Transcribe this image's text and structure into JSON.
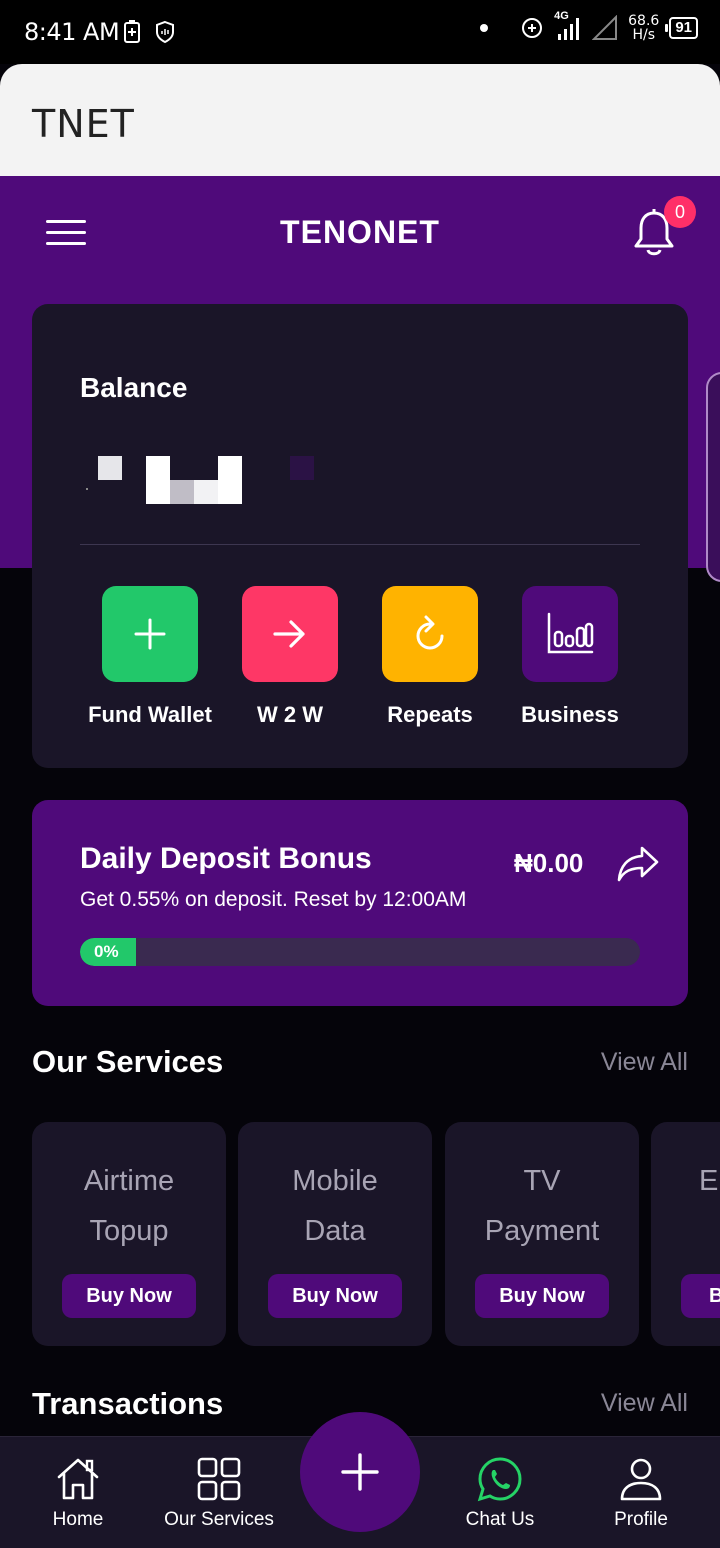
{
  "status_bar": {
    "time": "8:41 AM",
    "network": "4G",
    "speed_value": "68.6",
    "speed_unit": "H/s",
    "battery": "91"
  },
  "app": {
    "window_title": "TNET"
  },
  "header": {
    "brand": "TENONET",
    "notification_count": "0"
  },
  "balance": {
    "label": "Balance"
  },
  "actions": [
    {
      "label": "Fund Wallet",
      "icon": "plus-icon",
      "color": "#22c86a"
    },
    {
      "label": "W 2 W",
      "icon": "arrow-right-icon",
      "color": "#fe3766"
    },
    {
      "label": "Repeats",
      "icon": "refresh-icon",
      "color": "#ffb300"
    },
    {
      "label": "Business",
      "icon": "bar-chart-icon",
      "color": "#4f0a7a"
    }
  ],
  "bonus": {
    "title": "Daily Deposit Bonus",
    "amount": "₦0.00",
    "subtitle": "Get 0.55% on deposit. Reset by 12:00AM",
    "progress_label": "0%",
    "progress_fraction": 0
  },
  "services": {
    "title": "Our Services",
    "view_all": "View All",
    "items": [
      {
        "line1": "Airtime",
        "line2": "Topup",
        "button": "Buy Now"
      },
      {
        "line1": "Mobile",
        "line2": "Data",
        "button": "Buy Now"
      },
      {
        "line1": "TV",
        "line2": "Payment",
        "button": "Buy Now"
      },
      {
        "line1": "El",
        "line2": "",
        "button": "B"
      }
    ]
  },
  "transactions": {
    "title": "Transactions",
    "view_all": "View All"
  },
  "bottom_nav": {
    "items": [
      {
        "label": "Home",
        "icon": "home-icon"
      },
      {
        "label": "Our Services",
        "icon": "grid-icon"
      },
      {
        "label": "Chat Us",
        "icon": "whatsapp-icon"
      },
      {
        "label": "Profile",
        "icon": "profile-icon"
      }
    ],
    "fab_icon": "plus-icon"
  },
  "colors": {
    "primary_purple": "#4f0a7a",
    "card_bg": "#1a1528",
    "page_bg": "#05040a",
    "accent_green": "#22c86a",
    "accent_pink": "#fe3766",
    "accent_amber": "#ffb300",
    "badge_red": "#ff2f68"
  }
}
